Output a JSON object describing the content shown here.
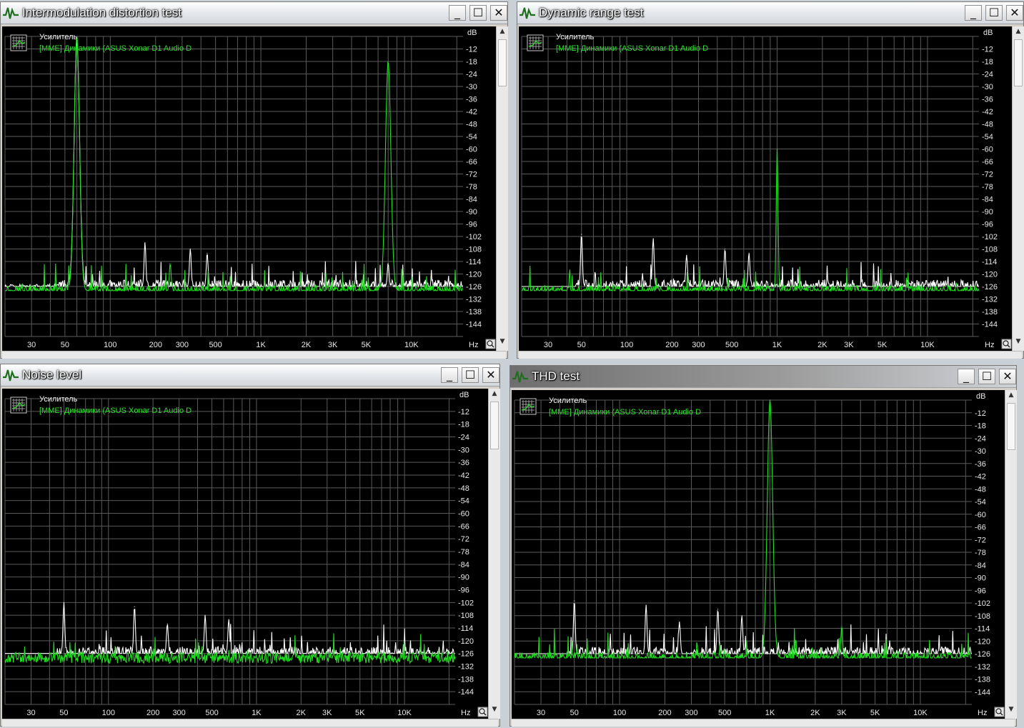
{
  "windows": [
    {
      "id": "imd",
      "title": "Intermodulation distortion test",
      "legend_title": "Усилитель",
      "legend_device": "[MME] Динамики (ASUS Xonar D1 Audio D",
      "db_label": "dB",
      "hz_label": "Hz",
      "active": false
    },
    {
      "id": "dr",
      "title": "Dynamic range test",
      "legend_title": "Усилитель",
      "legend_device": "[MME] Динамики (ASUS Xonar D1 Audio D",
      "db_label": "dB",
      "hz_label": "Hz",
      "active": false
    },
    {
      "id": "noise",
      "title": "Noise level",
      "legend_title": "Усилитель",
      "legend_device": "[MME] Динамики (ASUS Xonar D1 Audio D",
      "db_label": "dB",
      "hz_label": "Hz",
      "active": false
    },
    {
      "id": "thd",
      "title": "THD test",
      "legend_title": "Усилитель",
      "legend_device": "[MME] Динамики (ASUS Xonar D1 Audio D",
      "db_label": "dB",
      "hz_label": "Hz",
      "active": true
    }
  ],
  "controls": {
    "minimize": "_",
    "maximize": "☐",
    "close": "✕"
  },
  "axes": {
    "db_ticks": [
      "-12",
      "-18",
      "-24",
      "-30",
      "-36",
      "-42",
      "-48",
      "-54",
      "-60",
      "-66",
      "-72",
      "-78",
      "-84",
      "-90",
      "-96",
      "-102",
      "-108",
      "-114",
      "-120",
      "-126",
      "-132",
      "-138",
      "-144"
    ],
    "freq_ticks": [
      {
        "label": "30",
        "f": 30
      },
      {
        "label": "50",
        "f": 50
      },
      {
        "label": "100",
        "f": 100
      },
      {
        "label": "200",
        "f": 200
      },
      {
        "label": "300",
        "f": 300
      },
      {
        "label": "500",
        "f": 500
      },
      {
        "label": "1K",
        "f": 1000
      },
      {
        "label": "2K",
        "f": 2000
      },
      {
        "label": "3K",
        "f": 3000
      },
      {
        "label": "5K",
        "f": 5000
      },
      {
        "label": "10K",
        "f": 10000
      }
    ]
  },
  "colors": {
    "plot_background": "#000000",
    "grid": "#5a5a5a",
    "white_trace": "#ffffff",
    "green_trace": "#22dd22",
    "label": "#e8e8e8"
  },
  "chart_data": [
    {
      "type": "line",
      "window": "Intermodulation distortion test",
      "x_scale": "log",
      "xlim": [
        20,
        22000
      ],
      "ylim": [
        -150,
        -6
      ],
      "grid": true,
      "series": [
        {
          "color": "#22dd22",
          "peaks": [
            {
              "x": 60,
              "y": -6
            },
            {
              "x": 7000,
              "y": -18
            },
            {
              "x": 250,
              "y": -115
            }
          ]
        },
        {
          "color": "#ffffff",
          "peaks": [
            {
              "x": 60,
              "y": -8
            },
            {
              "x": 170,
              "y": -105
            },
            {
              "x": 340,
              "y": -108
            },
            {
              "x": 440,
              "y": -110
            },
            {
              "x": 7000,
              "y": -115
            }
          ]
        }
      ]
    },
    {
      "type": "line",
      "window": "Dynamic range test",
      "x_scale": "log",
      "xlim": [
        20,
        22000
      ],
      "ylim": [
        -150,
        -6
      ],
      "grid": true,
      "series": [
        {
          "color": "#22dd22",
          "peaks": [
            {
              "x": 1000,
              "y": -60
            }
          ]
        },
        {
          "color": "#ffffff",
          "peaks": [
            {
              "x": 50,
              "y": -101
            },
            {
              "x": 150,
              "y": -103
            },
            {
              "x": 250,
              "y": -111
            },
            {
              "x": 450,
              "y": -108
            },
            {
              "x": 650,
              "y": -110
            }
          ]
        }
      ]
    },
    {
      "type": "line",
      "window": "Noise level",
      "x_scale": "log",
      "xlim": [
        20,
        22000
      ],
      "ylim": [
        -150,
        -6
      ],
      "grid": true,
      "series": [
        {
          "color": "#22dd22",
          "peaks": []
        },
        {
          "color": "#ffffff",
          "peaks": [
            {
              "x": 50,
              "y": -102
            },
            {
              "x": 150,
              "y": -104
            },
            {
              "x": 250,
              "y": -112
            },
            {
              "x": 450,
              "y": -108
            },
            {
              "x": 650,
              "y": -110
            }
          ]
        }
      ]
    },
    {
      "type": "line",
      "window": "THD test",
      "x_scale": "log",
      "xlim": [
        20,
        22000
      ],
      "ylim": [
        -150,
        -6
      ],
      "grid": true,
      "series": [
        {
          "color": "#22dd22",
          "peaks": [
            {
              "x": 1000,
              "y": -6
            },
            {
              "x": 3000,
              "y": -113
            }
          ]
        },
        {
          "color": "#ffffff",
          "peaks": [
            {
              "x": 50,
              "y": -101
            },
            {
              "x": 150,
              "y": -103
            },
            {
              "x": 250,
              "y": -111
            },
            {
              "x": 450,
              "y": -105
            },
            {
              "x": 650,
              "y": -108
            }
          ]
        }
      ]
    }
  ]
}
